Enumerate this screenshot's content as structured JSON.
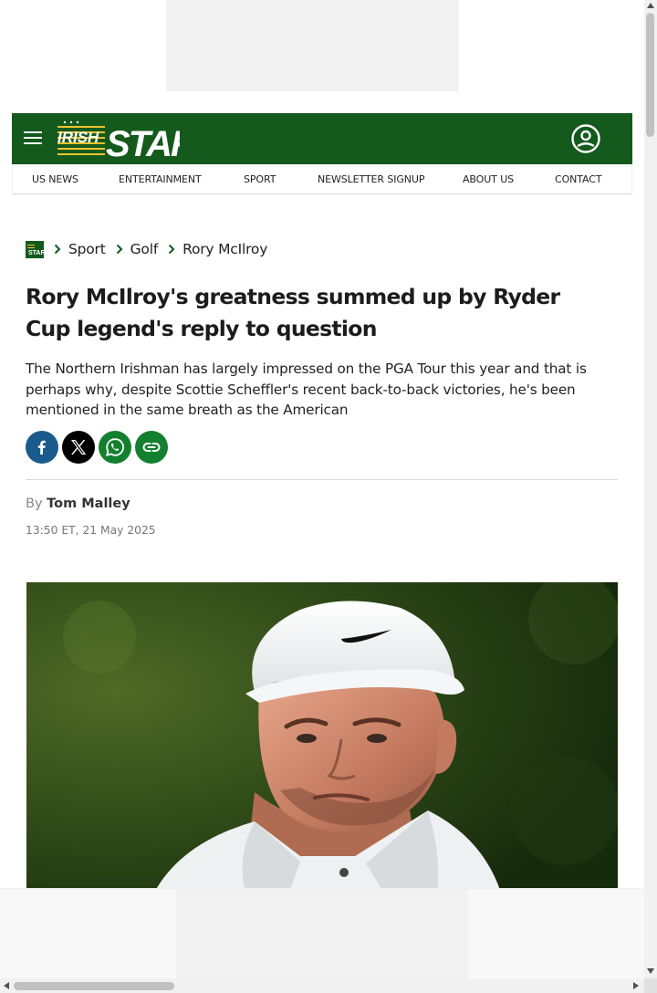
{
  "brand": {
    "logo_text_1": "IRISH",
    "logo_text_2": "STAR",
    "primary_color": "#135a1c",
    "accent_color": "#f2c230"
  },
  "header": {
    "menu_icon": "hamburger-menu-icon",
    "account_icon": "user-account-icon"
  },
  "nav": {
    "items": [
      "US NEWS",
      "ENTERTAINMENT",
      "SPORT",
      "NEWSLETTER SIGNUP",
      "ABOUT US",
      "CONTACT"
    ]
  },
  "breadcrumb": {
    "home_icon": "irish-star-home-icon",
    "items": [
      "Sport",
      "Golf",
      "Rory McIlroy"
    ]
  },
  "article": {
    "headline": "Rory McIlroy's greatness summed up by Ryder Cup legend's reply to question",
    "standfirst": "The Northern Irishman has largely impressed on the PGA Tour this year and that is perhaps why, despite Scottie Scheffler's recent back-to-back victories, he's been mentioned in the same breath as the American",
    "byline_prefix": "By",
    "author": "Tom Malley",
    "timestamp": "13:50 ET, 21 May 2025"
  },
  "share": {
    "buttons": [
      "facebook-icon",
      "x-icon",
      "whatsapp-icon",
      "copy-link-icon"
    ],
    "colors": {
      "facebook": "#1a5a8c",
      "x": "#000000",
      "whatsapp": "#12802f",
      "link": "#12802f"
    }
  }
}
